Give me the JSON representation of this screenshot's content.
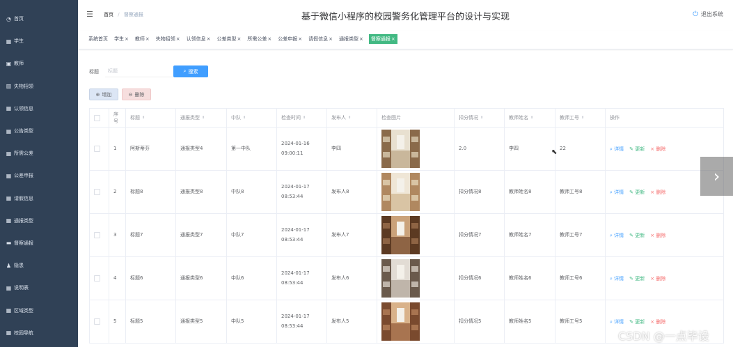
{
  "sidebar": {
    "items": [
      {
        "label": "首页",
        "icon": "home-icon",
        "glyph": "◔"
      },
      {
        "label": "学生",
        "icon": "grid-icon",
        "glyph": "▦"
      },
      {
        "label": "教师",
        "icon": "user-icon",
        "glyph": "▣"
      },
      {
        "label": "失物招领",
        "icon": "chart-icon",
        "glyph": "▥"
      },
      {
        "label": "认领信息",
        "icon": "grid-icon",
        "glyph": "▦"
      },
      {
        "label": "公告类型",
        "icon": "grid-icon",
        "glyph": "▦"
      },
      {
        "label": "所需公差",
        "icon": "grid-icon",
        "glyph": "▦"
      },
      {
        "label": "公差申报",
        "icon": "grid-icon",
        "glyph": "▦"
      },
      {
        "label": "请假信息",
        "icon": "grid-icon",
        "glyph": "▦"
      },
      {
        "label": "通报类型",
        "icon": "grid-icon",
        "glyph": "▦"
      },
      {
        "label": "督察通报",
        "icon": "monitor-icon",
        "glyph": "▬"
      },
      {
        "label": "隐患",
        "icon": "person-icon",
        "glyph": "♟"
      },
      {
        "label": "说明表",
        "icon": "grid-icon",
        "glyph": "▦"
      },
      {
        "label": "区域类型",
        "icon": "grid-icon",
        "glyph": "▦"
      },
      {
        "label": "校园导航",
        "icon": "grid-icon",
        "glyph": "▦"
      }
    ]
  },
  "header": {
    "breadcrumb_home": "首页",
    "breadcrumb_sep": "/",
    "breadcrumb_current": "督察通报",
    "title": "基于微信小程序的校园警务化管理平台的设计与实现",
    "logout": "退出系统"
  },
  "tags": [
    {
      "label": "系统首页",
      "closable": false,
      "active": false
    },
    {
      "label": "学生",
      "closable": true,
      "active": false
    },
    {
      "label": "教师",
      "closable": true,
      "active": false
    },
    {
      "label": "失物招领",
      "closable": true,
      "active": false
    },
    {
      "label": "认领信息",
      "closable": true,
      "active": false
    },
    {
      "label": "公差类型",
      "closable": true,
      "active": false
    },
    {
      "label": "所需公差",
      "closable": true,
      "active": false
    },
    {
      "label": "公差申报",
      "closable": true,
      "active": false
    },
    {
      "label": "请假信息",
      "closable": true,
      "active": false
    },
    {
      "label": "通报类型",
      "closable": true,
      "active": false
    },
    {
      "label": "督察通报",
      "closable": true,
      "active": true
    }
  ],
  "tag_close": "×",
  "search": {
    "label": "标题",
    "placeholder": "标题",
    "button": "搜索"
  },
  "actions": {
    "add": "增加",
    "delete": "删除"
  },
  "table": {
    "columns": [
      "序号",
      "标题",
      "通报类型",
      "中队",
      "检查时间",
      "发布人",
      "检查图片",
      "扣分情况",
      "教师姓名",
      "教师工号",
      "操作"
    ],
    "rows": [
      {
        "no": "1",
        "title": "阿斯蒂芬",
        "type": "通报类型4",
        "squad": "第一中队",
        "time": "2024-01-16 09:00:11",
        "publisher": "李四",
        "photo": "dorm-photo-1",
        "deduction": "2.0",
        "teacher": "李四",
        "teacher_no": "22"
      },
      {
        "no": "2",
        "title": "标题8",
        "type": "通报类型8",
        "squad": "中队8",
        "time": "2024-01-17 08:53:44",
        "publisher": "发布人8",
        "photo": "dorm-photo-2",
        "deduction": "扣分情况8",
        "teacher": "教师姓名8",
        "teacher_no": "教师工号8"
      },
      {
        "no": "3",
        "title": "标题7",
        "type": "通报类型7",
        "squad": "中队7",
        "time": "2024-01-17 08:53:44",
        "publisher": "发布人7",
        "photo": "dorm-photo-3",
        "deduction": "扣分情况7",
        "teacher": "教师姓名7",
        "teacher_no": "教师工号7"
      },
      {
        "no": "4",
        "title": "标题6",
        "type": "通报类型6",
        "squad": "中队6",
        "time": "2024-01-17 08:53:44",
        "publisher": "发布人6",
        "photo": "dorm-photo-4",
        "deduction": "扣分情况6",
        "teacher": "教师姓名6",
        "teacher_no": "教师工号6"
      },
      {
        "no": "5",
        "title": "标题5",
        "type": "通报类型5",
        "squad": "中队5",
        "time": "2024-01-17 08:53:44",
        "publisher": "发布人5",
        "photo": "dorm-photo-5",
        "deduction": "扣分情况5",
        "teacher": "教师姓名5",
        "teacher_no": "教师工号5"
      }
    ],
    "ops": {
      "detail": "详情",
      "edit": "更新",
      "delete": "删除"
    }
  },
  "watermark": "CSDN @一点毕设",
  "colors": {
    "sidebar_bg": "#304156",
    "primary": "#409eff",
    "active_tag": "#42b983",
    "danger": "#f56c6c"
  }
}
